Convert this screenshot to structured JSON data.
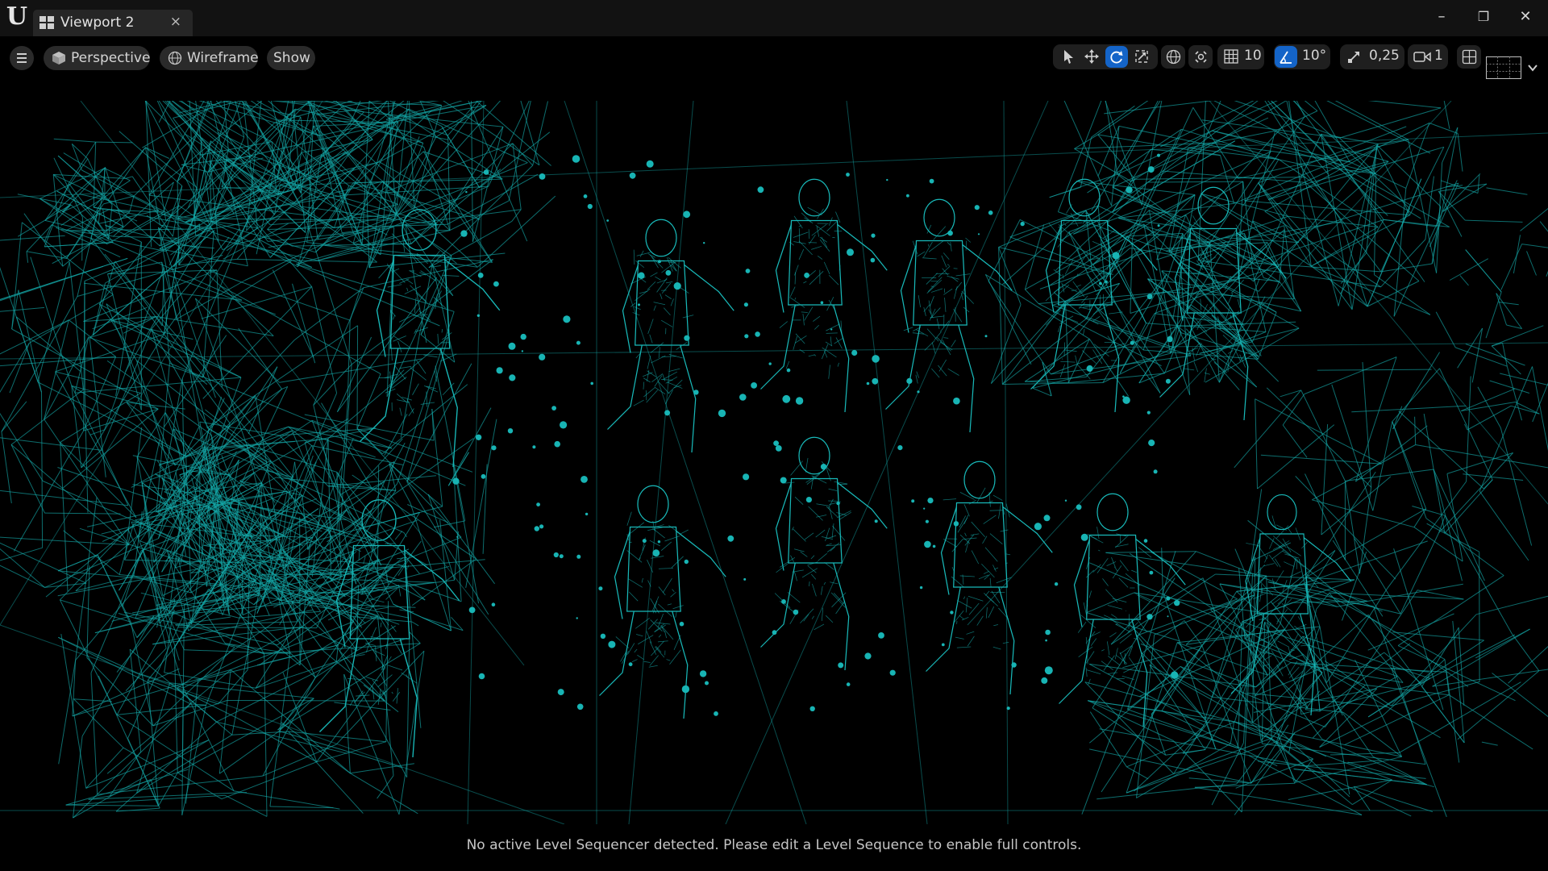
{
  "window": {
    "tab_title": "Viewport 2",
    "tab_close_glyph": "×",
    "minimize_glyph": "–",
    "restore_glyph": "❐",
    "close_glyph": "✕",
    "logo_glyph": "U"
  },
  "viewport_toolbar": {
    "perspective_label": "Perspective",
    "view_mode_label": "Wireframe",
    "show_label": "Show",
    "grid_snap_value": "10",
    "rotation_snap_value": "10°",
    "scale_snap_value": "0,25",
    "camera_speed_value": "1"
  },
  "status": {
    "message": "No active Level Sequencer detected. Please edit a Level Sequence to enable full controls."
  },
  "colors": {
    "wireframe": "#14b2b2",
    "background": "#000000",
    "accent_blue": "#1464c8"
  },
  "icons": [
    "unreal-logo-icon",
    "viewport-tab-icon",
    "hamburger-menu-icon",
    "cube-icon",
    "sphere-wire-icon",
    "select-arrow-icon",
    "translate-icon",
    "rotate-icon",
    "scale-icon",
    "world-icon",
    "surface-snap-icon",
    "grid-snap-icon",
    "angle-snap-icon",
    "scale-snap-icon",
    "camera-speed-icon",
    "layout-icon",
    "screen-layout-icon",
    "chevron-down-icon"
  ]
}
